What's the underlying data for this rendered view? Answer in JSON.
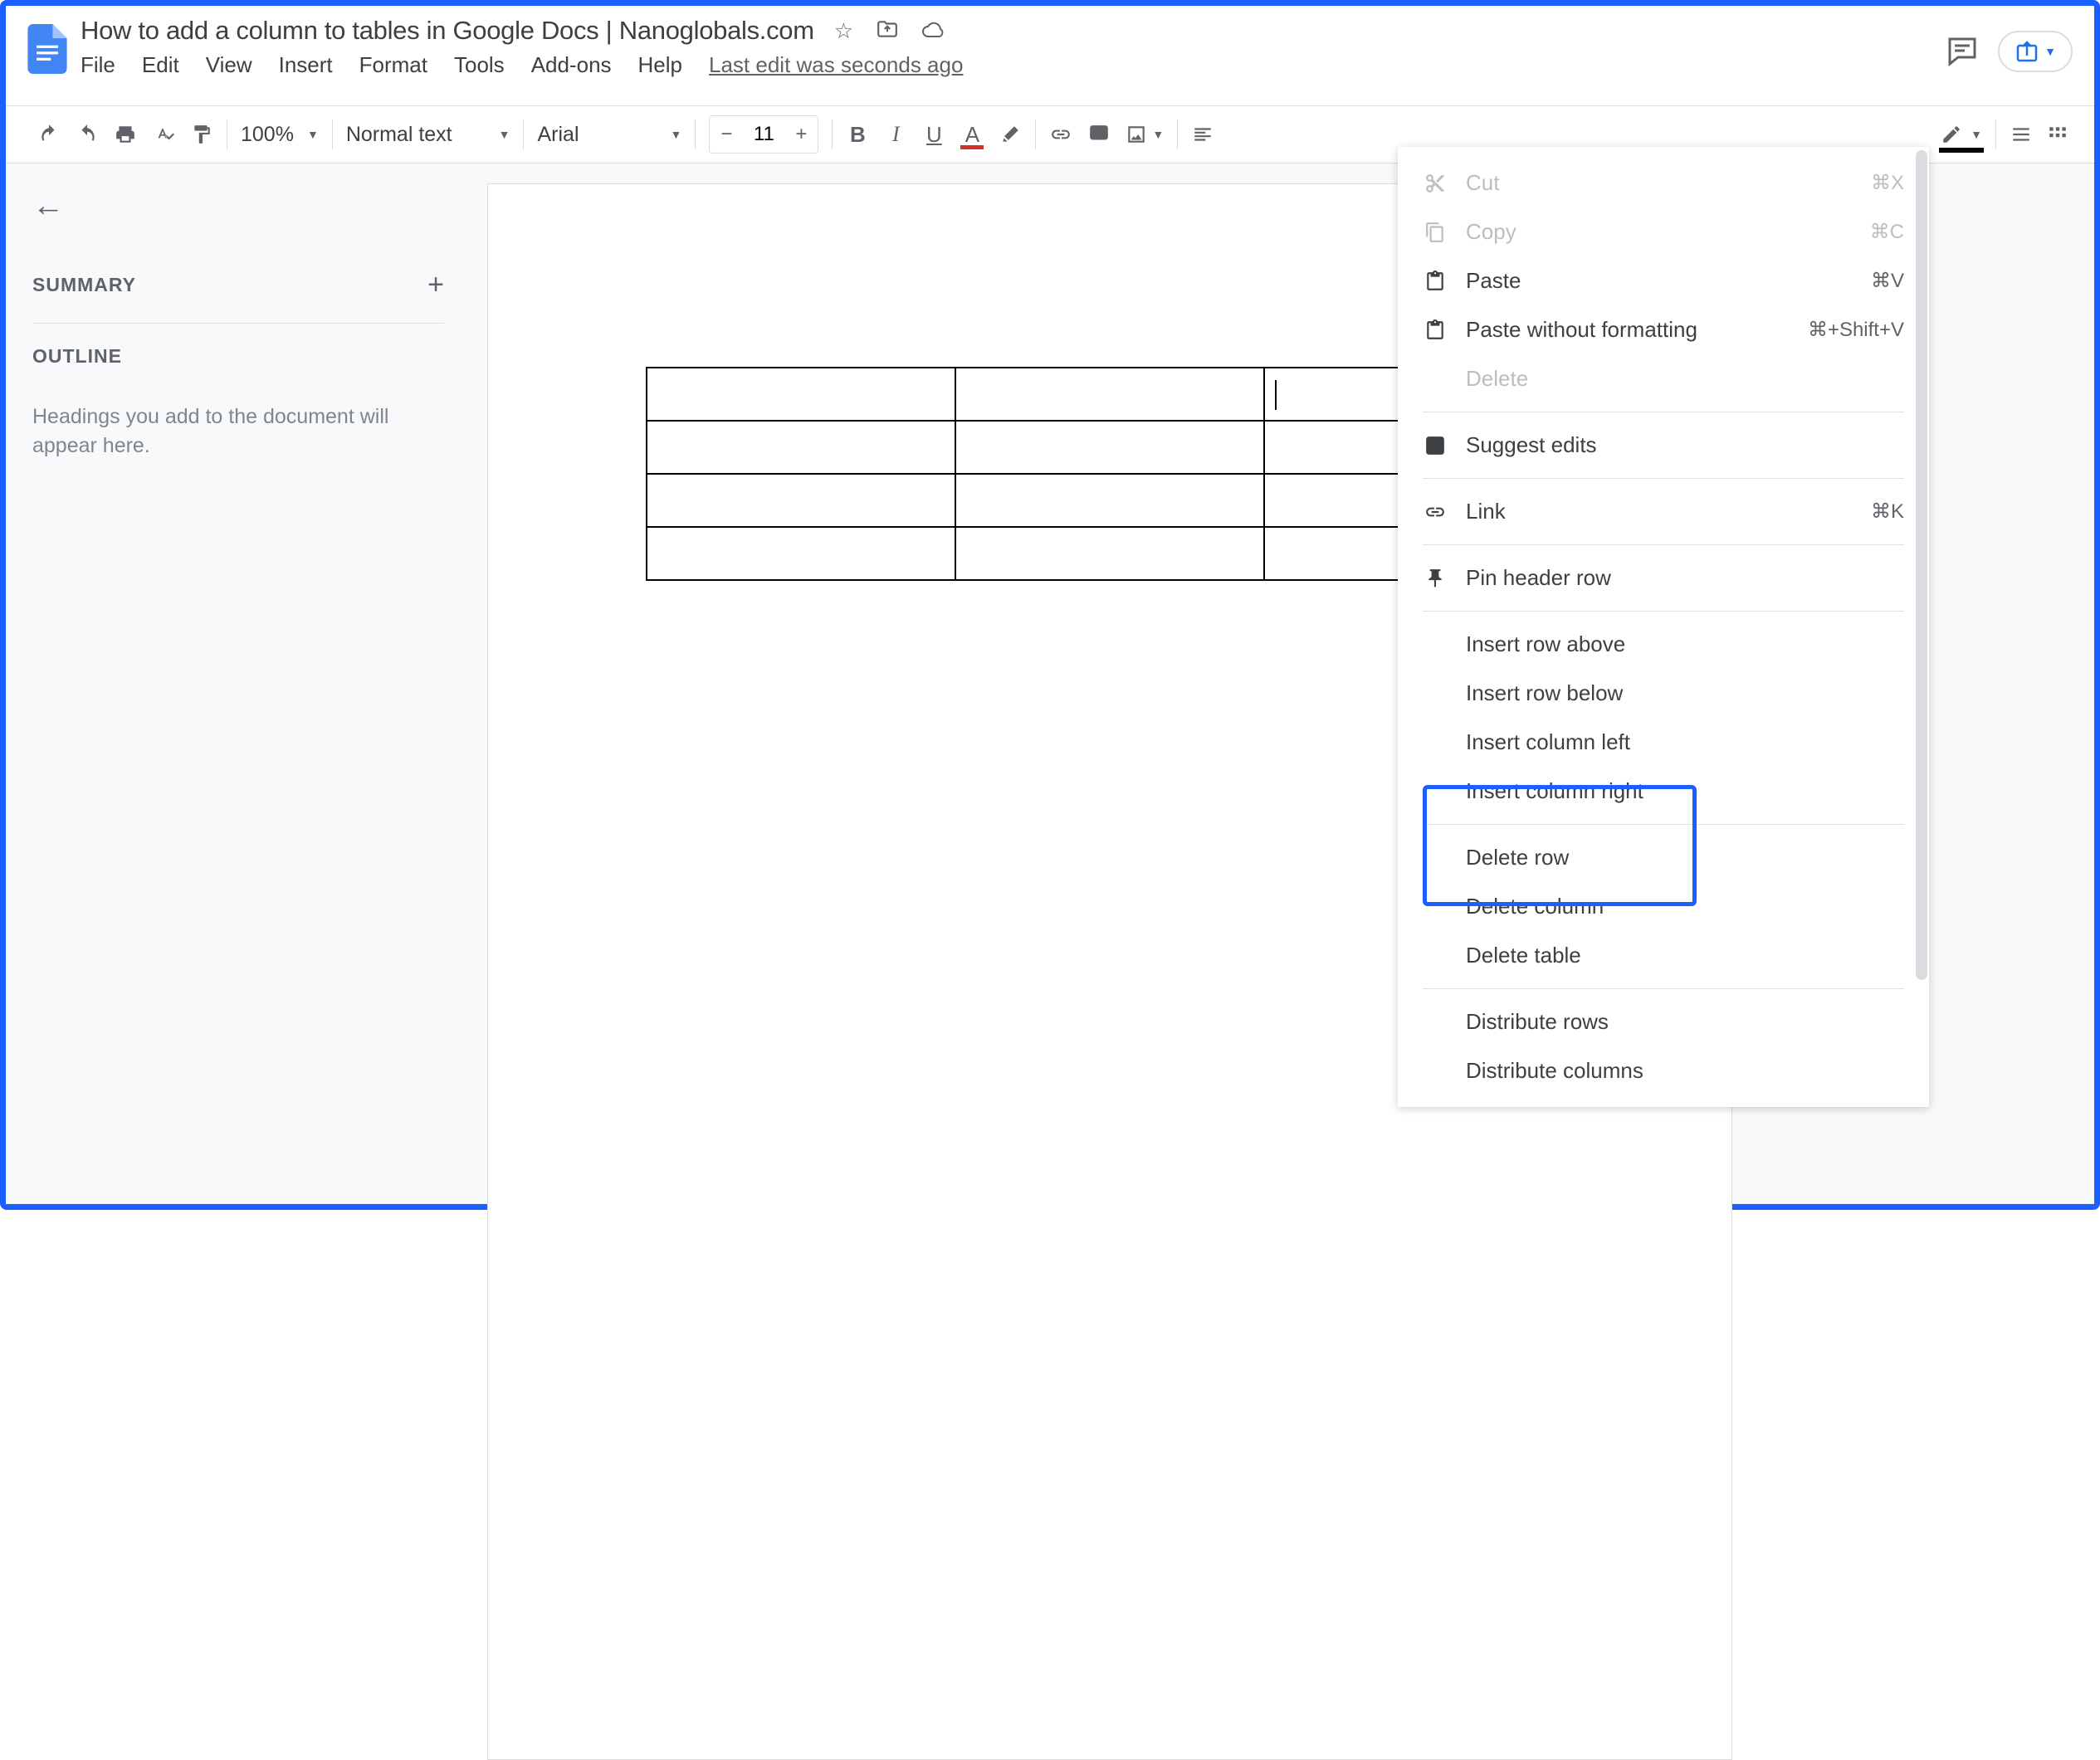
{
  "document": {
    "title": "How to add a column to tables in Google Docs | Nanoglobals.com",
    "edit_status": "Last edit was seconds ago"
  },
  "menu": {
    "file": "File",
    "edit": "Edit",
    "view": "View",
    "insert": "Insert",
    "format": "Format",
    "tools": "Tools",
    "addons": "Add-ons",
    "help": "Help"
  },
  "toolbar": {
    "zoom": "100%",
    "style": "Normal text",
    "font": "Arial",
    "font_size": "11"
  },
  "sidebar": {
    "summary": "SUMMARY",
    "outline": "OUTLINE",
    "outline_help": "Headings you add to the document will appear here."
  },
  "context_menu": {
    "cut": {
      "label": "Cut",
      "shortcut": "⌘X"
    },
    "copy": {
      "label": "Copy",
      "shortcut": "⌘C"
    },
    "paste": {
      "label": "Paste",
      "shortcut": "⌘V"
    },
    "paste_plain": {
      "label": "Paste without formatting",
      "shortcut": "⌘+Shift+V"
    },
    "delete": {
      "label": "Delete"
    },
    "suggest": {
      "label": "Suggest edits"
    },
    "link": {
      "label": "Link",
      "shortcut": "⌘K"
    },
    "pin_header": {
      "label": "Pin header row"
    },
    "insert_row_above": {
      "label": "Insert row above"
    },
    "insert_row_below": {
      "label": "Insert row below"
    },
    "insert_col_left": {
      "label": "Insert column left"
    },
    "insert_col_right": {
      "label": "Insert column right"
    },
    "delete_row": {
      "label": "Delete row"
    },
    "delete_col": {
      "label": "Delete column"
    },
    "delete_table": {
      "label": "Delete table"
    },
    "distribute_rows": {
      "label": "Distribute rows"
    },
    "distribute_cols": {
      "label": "Distribute columns"
    }
  }
}
